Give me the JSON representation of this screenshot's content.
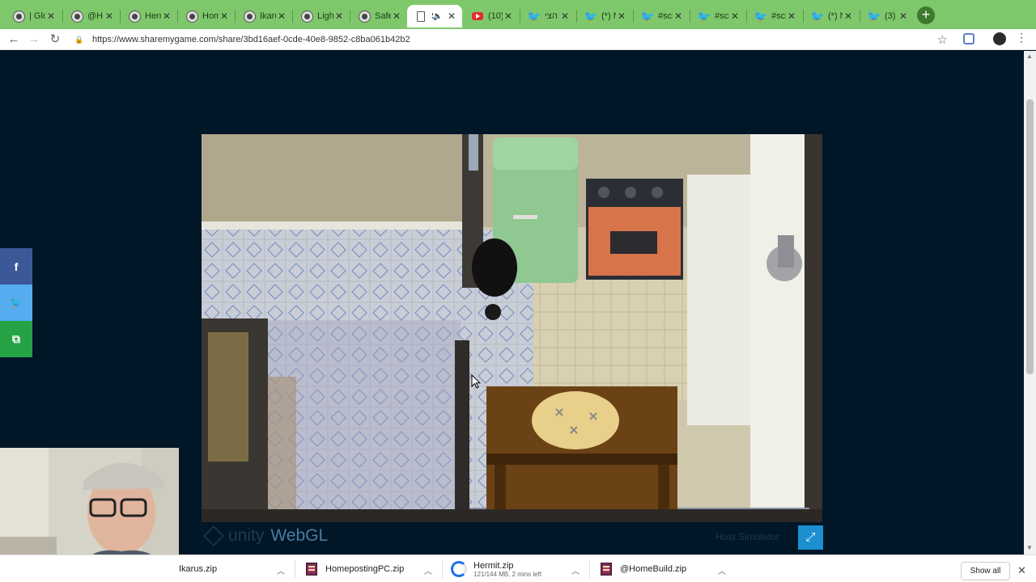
{
  "browser": {
    "tabs": [
      {
        "title": "| Glo",
        "icon": "globe-icon"
      },
      {
        "title": "@H",
        "icon": "globe-icon"
      },
      {
        "title": "Herm",
        "icon": "globe-icon"
      },
      {
        "title": "Hom",
        "icon": "globe-icon"
      },
      {
        "title": "Ikaru",
        "icon": "globe-icon"
      },
      {
        "title": "Ligh",
        "icon": "globe-icon"
      },
      {
        "title": "Safe",
        "icon": "globe-icon"
      },
      {
        "title": "S",
        "icon": "document-icon",
        "active": true
      },
      {
        "title": "(10)",
        "icon": "youtube-icon"
      },
      {
        "title": "הצי",
        "icon": "twitter-icon"
      },
      {
        "title": "(*) N",
        "icon": "twitter-icon"
      },
      {
        "title": "#sci",
        "icon": "twitter-icon"
      },
      {
        "title": "#sci",
        "icon": "twitter-icon"
      },
      {
        "title": "#sci",
        "icon": "twitter-icon"
      },
      {
        "title": "(*) N",
        "icon": "twitter-icon"
      },
      {
        "title": "(3)",
        "icon": "twitter-icon"
      }
    ],
    "url": "https://www.sharemygame.com/share/3bd16aef-0cde-40e8-9852-c8ba061b42b2",
    "tab_bar_color": "#7ec86b"
  },
  "page": {
    "background": "#011627",
    "social_buttons": [
      {
        "label": "f",
        "icon": "facebook-icon"
      },
      {
        "label": "t",
        "icon": "twitter-icon"
      },
      {
        "label": "⧉",
        "icon": "share-icon"
      }
    ],
    "game": {
      "engine_label": "unity",
      "platform_label": "WebGL",
      "title": "Host Simulator",
      "fullscreen_icon": "fullscreen-icon"
    }
  },
  "downloads": {
    "items": [
      {
        "name": "Ikarus.zip",
        "status": ""
      },
      {
        "name": "HomepostingPC.zip",
        "status": ""
      },
      {
        "name": "Hermit.zip",
        "status": "121/144 MB, 2 mins left"
      },
      {
        "name": "@HomeBuild.zip",
        "status": ""
      }
    ],
    "show_all_label": "Show all"
  }
}
